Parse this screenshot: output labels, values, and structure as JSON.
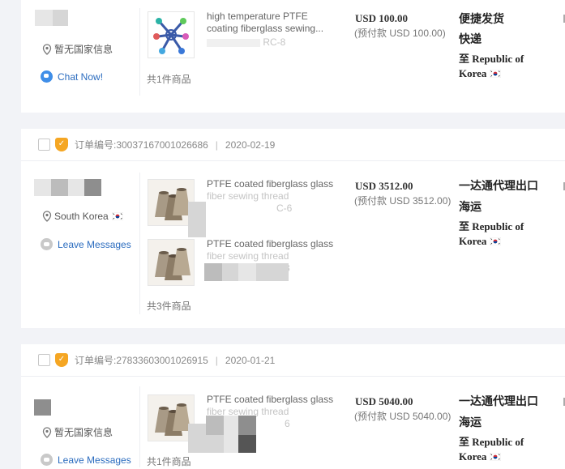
{
  "orders": [
    {
      "seller_location": "暂无国家信息",
      "contact_label": "Chat Now!",
      "products": [
        {
          "title": "high temperature PTFE coating fiberglass sewing...",
          "spec": "RC-8"
        }
      ],
      "item_count": "共1件商品",
      "price": "USD 100.00",
      "prepay": "(预付款 USD 100.00)",
      "shipping_method": "便捷发货",
      "shipping_method_2": "快递",
      "destination": "至 Republic of Korea"
    },
    {
      "order_number": "订单编号:30037167001026686",
      "order_date": "2020-02-19",
      "seller_location": "South Korea",
      "contact_label": "Leave Messages",
      "products": [
        {
          "title": "PTFE coated fiberglass glass",
          "title_2": "fiber sewing thread",
          "spec": "C-6"
        },
        {
          "title": "PTFE coated fiberglass glass",
          "title_2": "fiber sewing thread",
          "spec": "3"
        }
      ],
      "item_count": "共3件商品",
      "price": "USD 3512.00",
      "prepay": "(预付款 USD 3512.00)",
      "shipping_method": "一达通代理出口",
      "shipping_method_2": "海运",
      "destination": "至 Republic of Korea"
    },
    {
      "order_number": "订单编号:27833603001026915",
      "order_date": "2020-01-21",
      "seller_location": "暂无国家信息",
      "contact_label": "Leave Messages",
      "products": [
        {
          "title": "PTFE coated fiberglass glass",
          "title_2": "fiber sewing thread",
          "spec": "6"
        }
      ],
      "item_count": "共1件商品",
      "price": "USD 5040.00",
      "prepay": "(预付款 USD 5040.00)",
      "shipping_method": "一达通代理出口",
      "shipping_method_2": "海运",
      "destination": "至 Republic of Korea"
    }
  ],
  "icons": {
    "location": "map-pin-icon",
    "chat": "chat-bubble-icon",
    "message": "message-icon",
    "badge": "gold-supplier-badge-icon",
    "flag": "south-korea-flag-icon"
  },
  "colors": {
    "link": "#2b6cbf",
    "badge": "#f5a623",
    "background": "#f2f3f7"
  }
}
